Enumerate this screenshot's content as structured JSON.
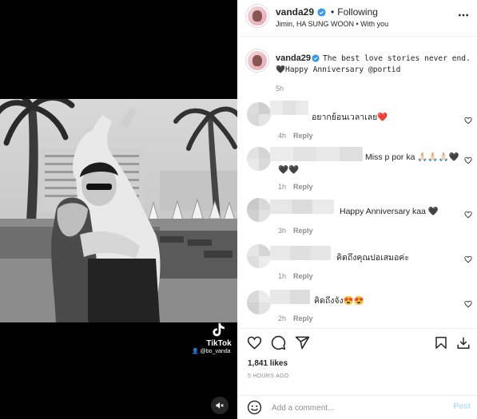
{
  "header": {
    "username": "vanda29",
    "separator": "•",
    "follow_state": "Following",
    "audience": "Jimin, HA SUNG WOON • With you"
  },
  "caption": {
    "username": "vanda29",
    "text": "The best love stories never end.",
    "text_line2": "🖤Happy Anniversary @portid",
    "time": "5h"
  },
  "media": {
    "watermark_brand": "TikTok",
    "watermark_user": "@bo_vanda"
  },
  "comments": [
    {
      "text": "อยากย้อนเวลาเลย❤️",
      "time": "4h",
      "reply": "Reply"
    },
    {
      "text": "Miss p por ka 🙏🏻🙏🏻🙏🏻🖤",
      "text_line2": "🖤🖤",
      "time": "1h",
      "reply": "Reply"
    },
    {
      "text": "Happy Anniversary kaa 🖤",
      "time": "3h",
      "reply": "Reply"
    },
    {
      "text": "คิดถึงคุณปอเสมอค่ะ",
      "time": "1h",
      "reply": "Reply"
    },
    {
      "text": "คิดถึงจัง😍😍",
      "time": "2h",
      "reply": "Reply"
    }
  ],
  "stats": {
    "likes": "1,841 likes",
    "posted": "5 HOURS AGO"
  },
  "compose": {
    "placeholder": "Add a comment...",
    "post_label": "Post"
  },
  "colors": {
    "verified": "#3897f0",
    "muted_text": "#8e8e8e",
    "post_button": "#b2dffc"
  }
}
